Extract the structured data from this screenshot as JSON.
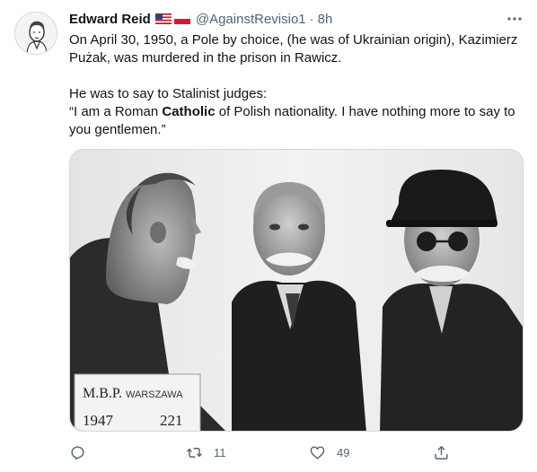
{
  "tweet": {
    "author": {
      "name": "Edward Reid",
      "handle": "@AgainstRevisio1",
      "separator": "·",
      "time": "8h"
    },
    "text": {
      "line1": "On April 30, 1950, a Pole by choice, (he was of Ukrainian origin), Kazimierz",
      "line2": "Pużak, was murdered in the prison in Rawicz.",
      "line3": "He was to say to Stalinist judges:",
      "line4_pre": " “I am a Roman ",
      "line4_bold": "Catholic",
      "line4_post": " of Polish nationality. I have nothing more to say to",
      "line5": "you gentlemen.”"
    },
    "photo": {
      "sign_line1_a": "M.B.P.",
      "sign_line1_b": "WARSZAWA",
      "sign_line2_a": "1947",
      "sign_line2_b": "221"
    },
    "actions": {
      "reply_count": "",
      "retweet_count": "11",
      "like_count": "49"
    },
    "colors": {
      "text": "#0f1419",
      "secondary": "#536471",
      "border": "#cfd9de"
    }
  }
}
